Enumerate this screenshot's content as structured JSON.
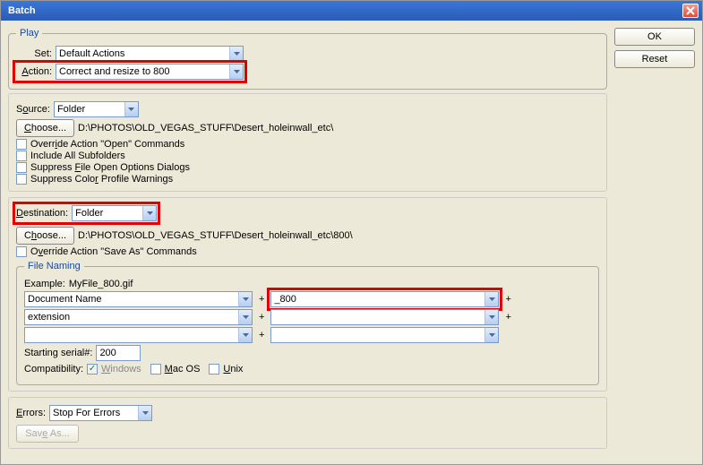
{
  "title": "Batch",
  "buttons": {
    "ok": "OK",
    "reset": "Reset"
  },
  "play": {
    "legend": "Play",
    "set_label": "Set:",
    "set_value": "Default Actions",
    "action_label": "Action:",
    "action_value": "Correct and resize to 800"
  },
  "source": {
    "label": "Source:",
    "value": "Folder",
    "choose": "Choose...",
    "path": "D:\\PHOTOS\\OLD_VEGAS_STUFF\\Desert_holeinwall_etc\\",
    "override": "Override Action \"Open\" Commands",
    "subfolders": "Include All Subfolders",
    "suppressFile": "Suppress File Open Options Dialogs",
    "suppressColor": "Suppress Color Profile Warnings"
  },
  "destination": {
    "label": "Destination:",
    "value": "Folder",
    "choose": "Choose...",
    "path": "D:\\PHOTOS\\OLD_VEGAS_STUFF\\Desert_holeinwall_etc\\800\\",
    "override": "Override Action \"Save As\" Commands"
  },
  "filenaming": {
    "legend": "File Naming",
    "example_label": "Example:",
    "example_value": "MyFile_800.gif",
    "field1": "Document Name",
    "field2": "_800",
    "field3": "extension",
    "field4": "",
    "field5": "",
    "field6": "",
    "serial_label": "Starting serial#:",
    "serial_value": "200",
    "compat_label": "Compatibility:",
    "windows": "Windows",
    "mac": "Mac OS",
    "unix": "Unix"
  },
  "errors": {
    "label": "Errors:",
    "value": "Stop For Errors",
    "save": "Save As..."
  }
}
